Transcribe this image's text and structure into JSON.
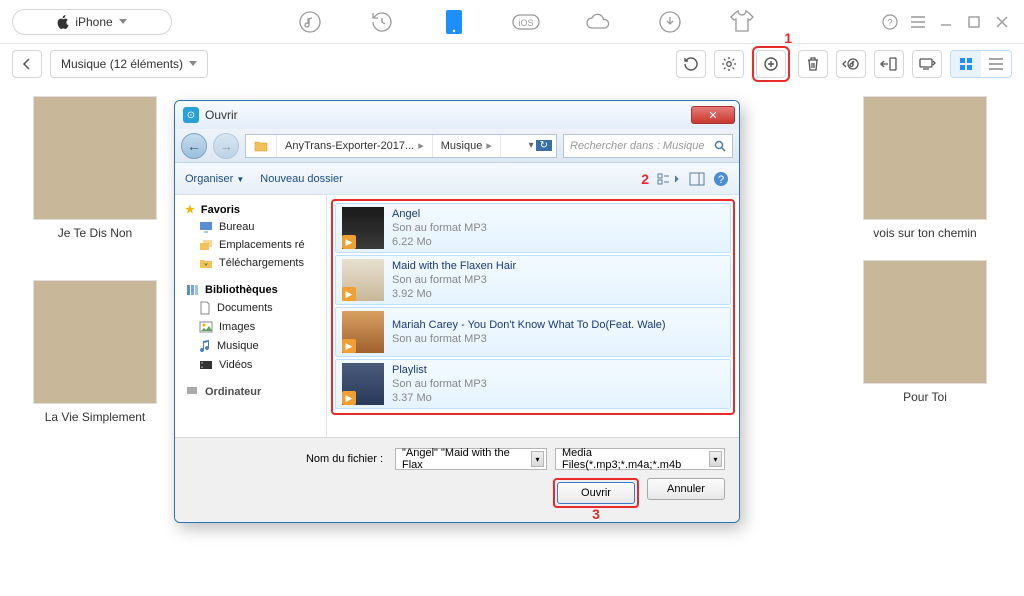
{
  "device": {
    "name": "iPhone"
  },
  "breadcrumb": {
    "label": "Musique (12 éléments)"
  },
  "annotations": {
    "n1": "1",
    "n2": "2",
    "n3": "3"
  },
  "albums": {
    "a1": {
      "title": "Je Te Dis Non"
    },
    "a2": {
      "title": "La Vie Simplement"
    },
    "a3": {
      "title": "vois sur ton chemin"
    },
    "a4": {
      "title": "Pour Toi"
    }
  },
  "dialog": {
    "title": "Ouvrir",
    "navPath1": "AnyTrans-Exporter-2017...",
    "navPath2": "Musique",
    "searchPlaceholder": "Rechercher dans : Musique",
    "tools": {
      "organize": "Organiser",
      "newFolder": "Nouveau dossier"
    },
    "sidebar": {
      "favHeader": "Favoris",
      "bureau": "Bureau",
      "emplacements": "Emplacements ré",
      "telechargements": "Téléchargements",
      "bibHeader": "Bibliothèques",
      "documents": "Documents",
      "images": "Images",
      "musique": "Musique",
      "videos": "Vidéos",
      "ordinateur": "Ordinateur"
    },
    "files": [
      {
        "name": "Angel",
        "type": "Son au format MP3",
        "size": "6.22 Mo"
      },
      {
        "name": "Maid with the Flaxen Hair",
        "type": "Son au format MP3",
        "size": "3.92 Mo"
      },
      {
        "name": "Mariah Carey - You Don't Know What To Do(Feat. Wale)",
        "type": "Son au format MP3",
        "size": ""
      },
      {
        "name": "Playlist",
        "type": "Son au format MP3",
        "size": "3.37 Mo"
      }
    ],
    "footer": {
      "fileLabel": "Nom du fichier :",
      "fileValue": "\"Angel\" \"Maid with the Flax",
      "filter": "Media Files(*.mp3;*.m4a;*.m4b",
      "open": "Ouvrir",
      "cancel": "Annuler"
    }
  }
}
